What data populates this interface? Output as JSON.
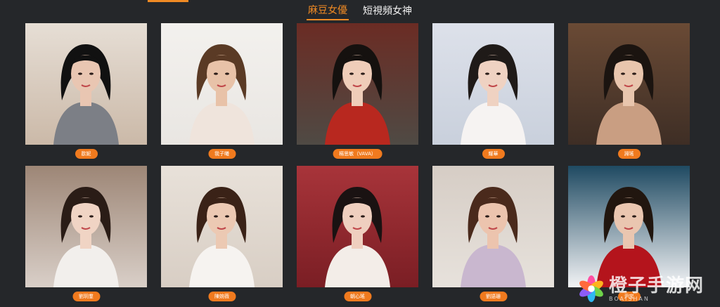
{
  "tabs": [
    {
      "label": "麻豆女優",
      "active": true
    },
    {
      "label": "短視頻女神",
      "active": false
    }
  ],
  "accent_color": "#f08a24",
  "actresses": [
    {
      "name": "歐妮",
      "bg": "#cbb9a8",
      "top": "#e6ded5",
      "hair": "#111111",
      "skin": "#e9c6b2",
      "cloth": "#7c7f86"
    },
    {
      "name": "我子曦",
      "bg": "#e9e6e2",
      "top": "#f3f1ee",
      "hair": "#5a3a25",
      "skin": "#e8c2a8",
      "cloth": "#efe4dc"
    },
    {
      "name": "楊思敏（VAVA）",
      "bg": "#4f4a44",
      "top": "#6b2c24",
      "hair": "#15110f",
      "skin": "#efcdb9",
      "cloth": "#b8281f"
    },
    {
      "name": "耀華",
      "bg": "#c9d0dc",
      "top": "#dde1ea",
      "hair": "#1f1a18",
      "skin": "#efd2c2",
      "cloth": "#f6f3f2"
    },
    {
      "name": "淵瑤",
      "bg": "#3e2e25",
      "top": "#6a4a35",
      "hair": "#1b1410",
      "skin": "#e8c5ad",
      "cloth": "#c99e82"
    },
    {
      "name": "劉玥羣",
      "bg": "#d9cfc8",
      "top": "#9d8676",
      "hair": "#2a1c16",
      "skin": "#f0d4c4",
      "cloth": "#f2efec"
    },
    {
      "name": "陳婉薇",
      "bg": "#d8cec4",
      "top": "#e8e1d9",
      "hair": "#3a2217",
      "skin": "#ecc9b3",
      "cloth": "#f6f3f0"
    },
    {
      "name": "朝心瑤",
      "bg": "#7a1e24",
      "top": "#a8343a",
      "hair": "#1a1212",
      "skin": "#efcfbf",
      "cloth": "#f3ede8"
    },
    {
      "name": "劉語珊",
      "bg": "#e7e2dc",
      "top": "#d6cdc5",
      "hair": "#4a2a1c",
      "skin": "#ecc4ae",
      "cloth": "#c9b7cf"
    },
    {
      "name": "尹宝",
      "bg": "#f2f3f5",
      "top": "#1f4a62",
      "hair": "#21160f",
      "skin": "#eac6b0",
      "cloth": "#b4141c"
    }
  ],
  "watermark": {
    "title": "橙子手游网",
    "subtitle": "BOAISHAN"
  }
}
